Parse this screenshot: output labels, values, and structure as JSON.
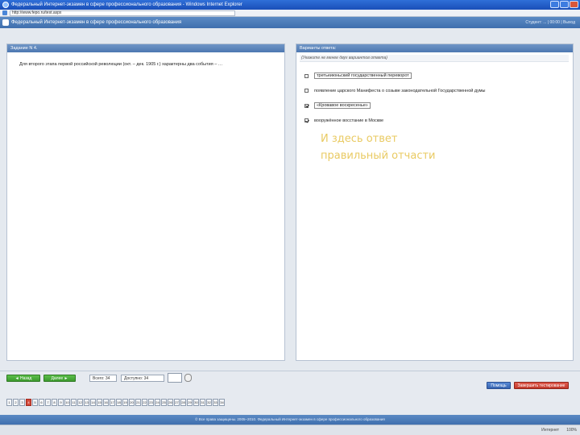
{
  "window": {
    "title": "Федеральный Интернет-экзамен в сфере профессионального образования - Windows Internet Explorer",
    "url": "http://www.fepo.ru/test.aspx"
  },
  "app": {
    "title": "Федеральный Интернет-экзамен в сфере профессионального образования",
    "right_info": "Студент: ... | 00:00 | Выход"
  },
  "question": {
    "header": "Задание N 4.",
    "text": "Для второго этапа первой российской революции (окт. – дек. 1905 г.) характерны два события – …"
  },
  "answers": {
    "header": "Варианты ответа:",
    "instruction": "(Укажите не менее двух вариантов ответа)",
    "options": [
      {
        "label": "третьеиюньский государственный переворот",
        "checked": false
      },
      {
        "label": "появление царского Манифеста о созыве законодательной Государственной думы",
        "checked": false
      },
      {
        "label": "«Кровавое воскресенье»",
        "checked": true
      },
      {
        "label": "вооружённое восстание в Москве",
        "checked": true
      }
    ]
  },
  "annotation": {
    "line1": "И здесь ответ",
    "line2": "правильный отчасти"
  },
  "toolbar": {
    "back_label": "◄ Назад",
    "forward_label": "Далее ►",
    "total_label": "Всего: 34",
    "available_label": "Доступно: 34",
    "help_label": "Помощь",
    "finish_label": "Завершить тестирование",
    "current_question": 4,
    "question_numbers": [
      "1",
      "2",
      "3",
      "4",
      "5",
      "6",
      "7",
      "8",
      "9",
      "10",
      "11",
      "12",
      "13",
      "14",
      "15",
      "16",
      "17",
      "18",
      "19",
      "20",
      "21",
      "22",
      "23",
      "24",
      "25",
      "26",
      "27",
      "28",
      "29",
      "30",
      "31",
      "32",
      "33",
      "34"
    ]
  },
  "footer": {
    "text": "© Все права защищены. 2005–2010. Федеральный Интернет-экзамен в сфере профессионального образования"
  },
  "status": {
    "zone": "Интернет",
    "zoom": "100%"
  }
}
